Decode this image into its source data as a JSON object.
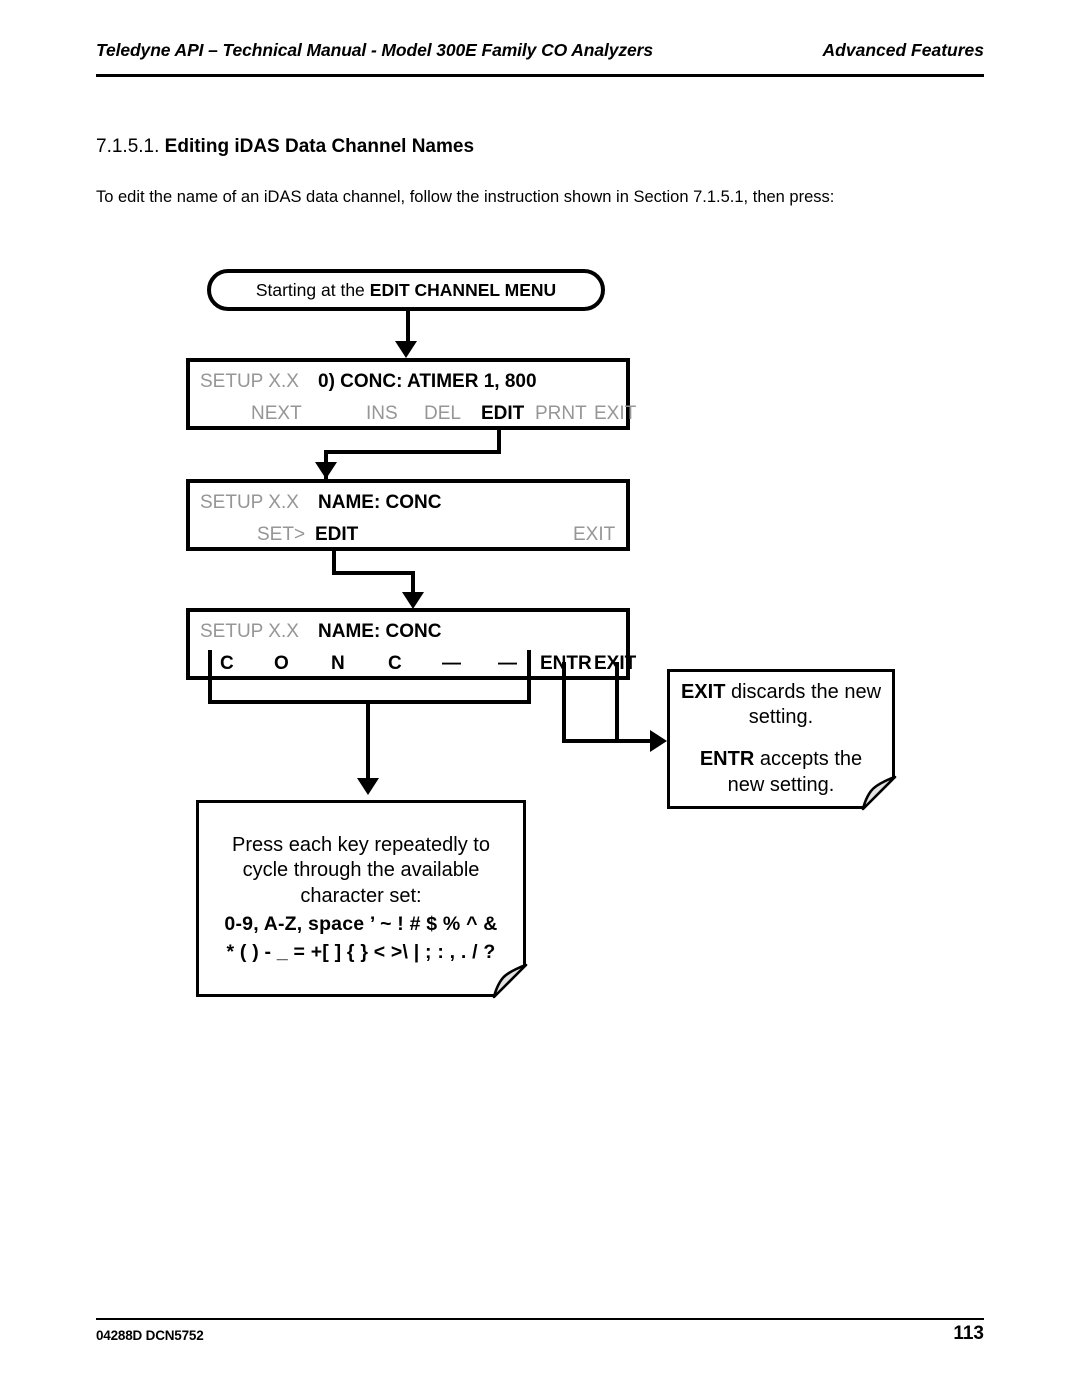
{
  "header": {
    "left": "Teledyne API – Technical Manual - Model 300E Family CO Analyzers",
    "right": "Advanced Features"
  },
  "section": {
    "number": "7.1.5.1.",
    "title": "Editing iDAS Data Channel Names",
    "paragraph": "To edit the name of an iDAS data channel, follow the instruction shown in Section 7.1.5.1, then press:"
  },
  "flow": {
    "start": {
      "prefix": "Starting at the",
      "emphasis": "EDIT CHANNEL MENU"
    },
    "display1": {
      "menu_label": "SETUP X.X",
      "title": "0) CONC:  ATIMER 1, 800",
      "keys": [
        {
          "label": "NEXT",
          "state": "inactive"
        },
        {
          "label": "INS",
          "state": "inactive"
        },
        {
          "label": "DEL",
          "state": "inactive"
        },
        {
          "label": "EDIT",
          "state": "active"
        },
        {
          "label": "PRNT",
          "state": "inactive"
        },
        {
          "label": "EXIT",
          "state": "inactive"
        }
      ]
    },
    "display2": {
      "menu_label": "SETUP X.X",
      "title": "NAME: CONC",
      "keys": [
        {
          "label": "SET>",
          "state": "inactive"
        },
        {
          "label": "EDIT",
          "state": "active"
        },
        {
          "label": "EXIT",
          "state": "inactive"
        }
      ]
    },
    "display3": {
      "menu_label": "SETUP X.X",
      "title": "NAME: CONC",
      "char_keys": [
        "C",
        "O",
        "N",
        "C",
        "—",
        "—"
      ],
      "action_keys": [
        "ENTR",
        "EXIT"
      ]
    },
    "note_entr": {
      "line1_bold": "EXIT",
      "line1_rest": " discards the new",
      "line2": "setting.",
      "line3_bold": "ENTR",
      "line3_rest": " accepts the",
      "line4": "new setting."
    },
    "note_charset": {
      "line1": "Press each key repeatedly to",
      "line2": "cycle through the available",
      "line3": "character set:",
      "charset_line1": "0-9, A-Z, space ’ ~ ! # $ % ^ &",
      "charset_line2": "* ( ) - _ = +[ ] { } < >\\ | ; : , . / ?"
    }
  },
  "footer": {
    "doc_id": "04288D DCN5752",
    "page_number": "113"
  }
}
